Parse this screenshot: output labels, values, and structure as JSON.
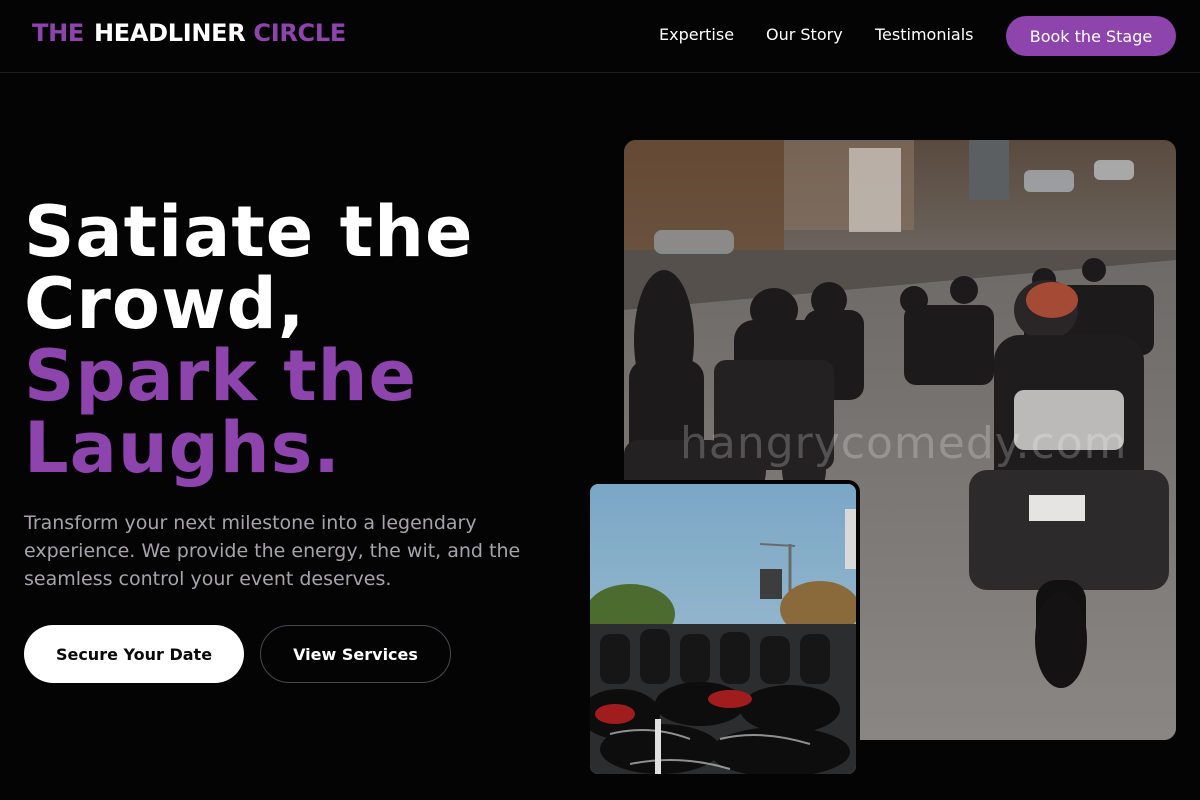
{
  "nav": {
    "logo_part1": "THE",
    "logo_part2": "HEADLINER",
    "logo_part3": "CIRCLE",
    "links": [
      "Expertise",
      "Our Story",
      "Testimonials"
    ],
    "cta_label": "Book the Stage"
  },
  "hero": {
    "headline_line1": "Satiate the",
    "headline_line2": "Crowd,",
    "headline_accent_line1": "Spark the",
    "headline_accent_line2": "Laughs.",
    "description": "Transform your next milestone into a legendary experience. We provide the energy, the wit, and the seamless control your event deserves.",
    "primary_button": "Secure Your Date",
    "secondary_button": "View Services"
  },
  "images": {
    "main_watermark": "hangrycomedy.com",
    "main_photo_icon": "motorcycle-riders-photo",
    "small_photo_icon": "parked-motorcycles-photo"
  },
  "colors": {
    "accent": "#8e44ad",
    "background": "#050405",
    "muted_text": "#a6a3ab"
  }
}
